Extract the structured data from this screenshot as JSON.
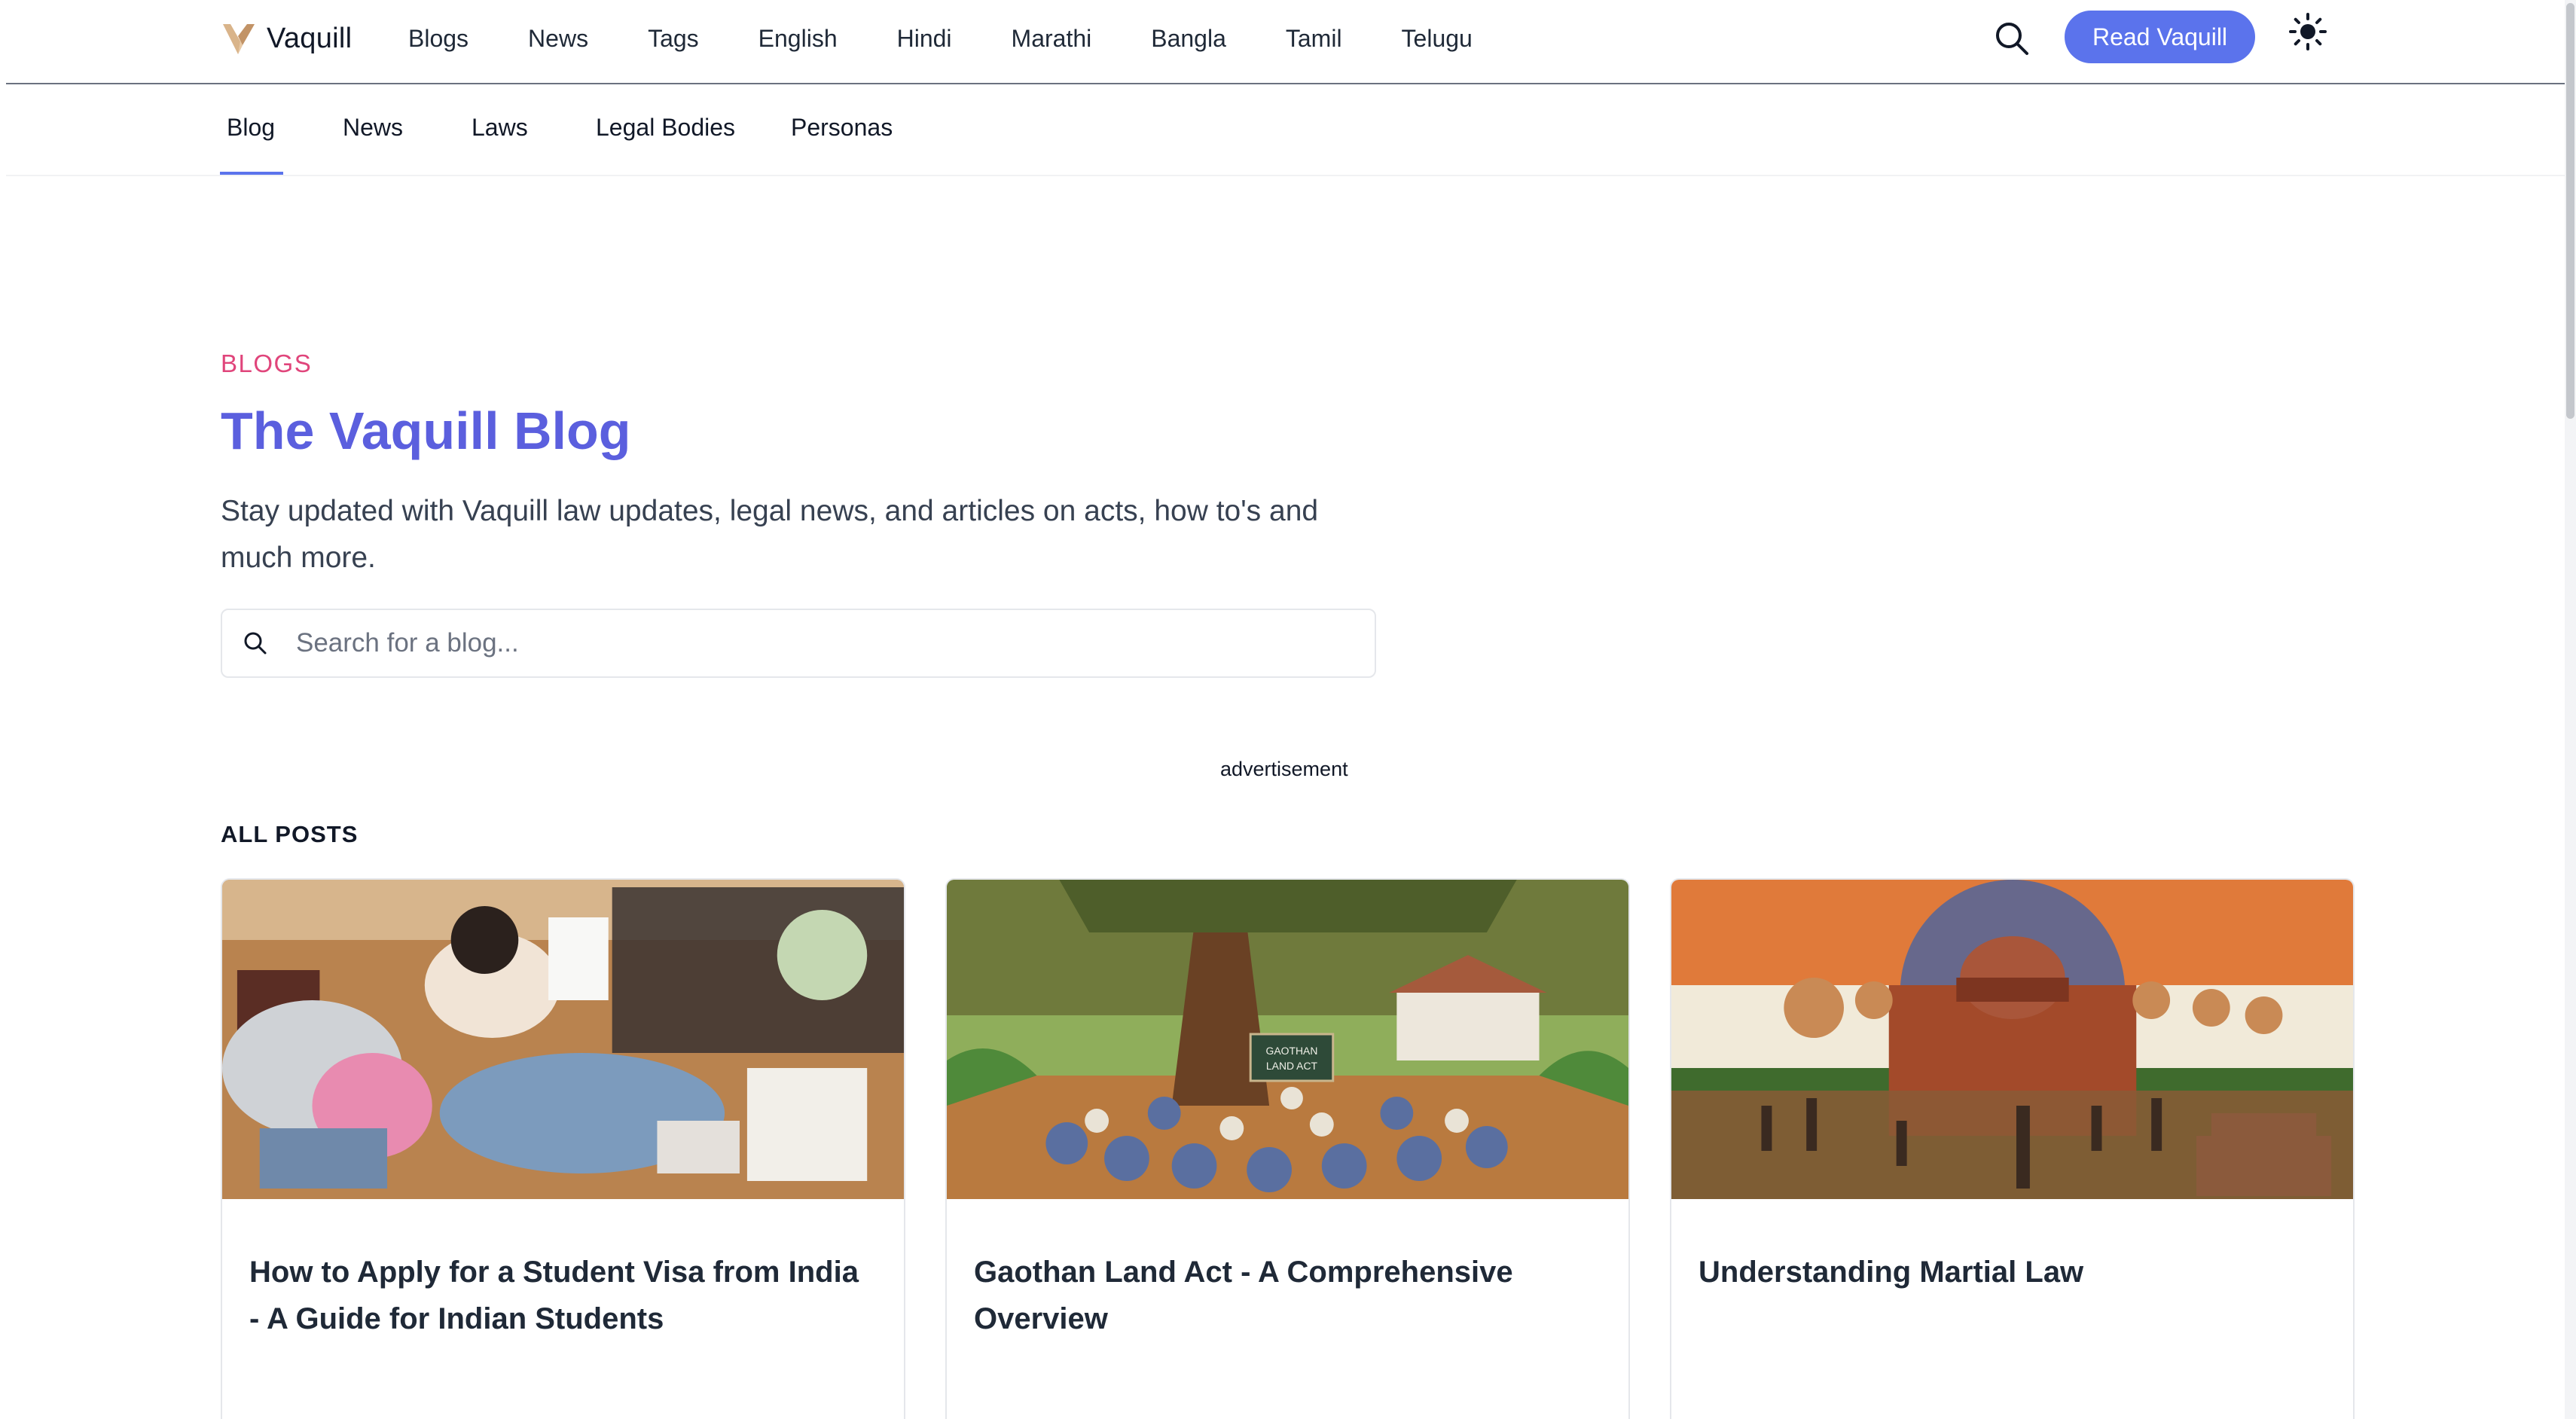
{
  "brand": {
    "name": "Vaquill"
  },
  "topnav": {
    "links": [
      "Blogs",
      "News",
      "Tags",
      "English",
      "Hindi",
      "Marathi",
      "Bangla",
      "Tamil",
      "Telugu"
    ],
    "read_label": "Read Vaquill",
    "accent": "#5b73ec"
  },
  "subnav": {
    "tabs": [
      "Blog",
      "News",
      "Laws",
      "Legal Bodies",
      "Personas"
    ],
    "active": "Blog"
  },
  "hero": {
    "eyebrow": "BLOGS",
    "title": "The Vaquill Blog",
    "subtitle": "Stay updated with Vaquill law updates, legal news, and articles on acts, how to's and much more.",
    "eyebrow_color": "#e0457b",
    "title_color": "#5b5fde"
  },
  "search": {
    "placeholder": "Search for a blog...",
    "value": ""
  },
  "advertisement_label": "advertisement",
  "posts": {
    "heading": "ALL POSTS",
    "items": [
      {
        "title": "How to Apply for a Student Visa from India - A Guide for Indian Students",
        "image": "student-visa-illustration"
      },
      {
        "title": "Gaothan Land Act - A Comprehensive Overview",
        "image": "village-banyan-tree-illustration",
        "image_sign": "GAOTHAN LAND ACT"
      },
      {
        "title": "Understanding Martial Law",
        "image": "martial-law-illustration"
      }
    ]
  }
}
